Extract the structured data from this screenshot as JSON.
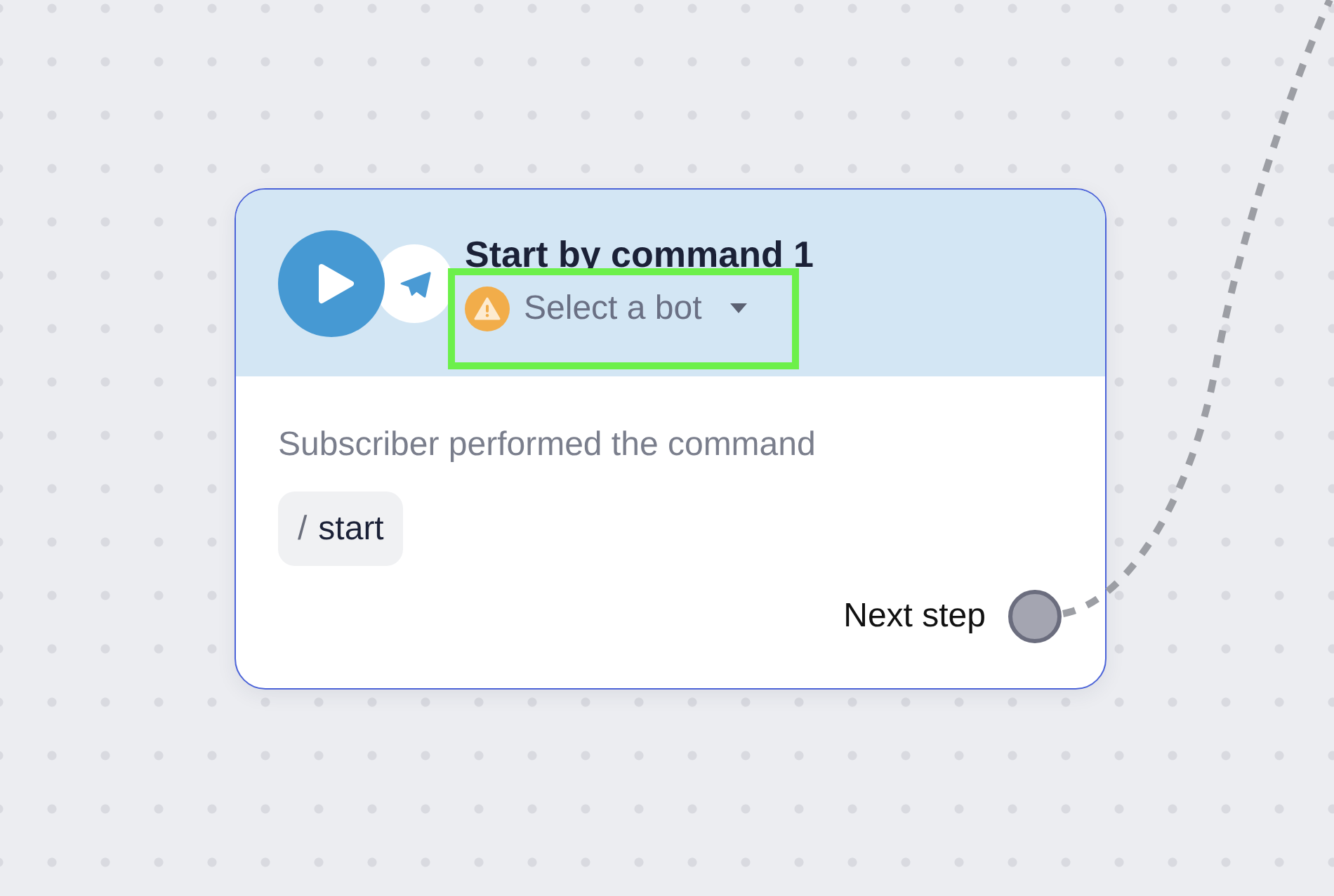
{
  "node": {
    "title": "Start by command 1",
    "bot_select": {
      "placeholder": "Select a bot",
      "warning": true,
      "highlighted": true
    },
    "description": "Subscriber performed the command",
    "command": {
      "prefix": "/",
      "name": "start"
    },
    "next_step": {
      "label": "Next step",
      "connected": true
    }
  }
}
